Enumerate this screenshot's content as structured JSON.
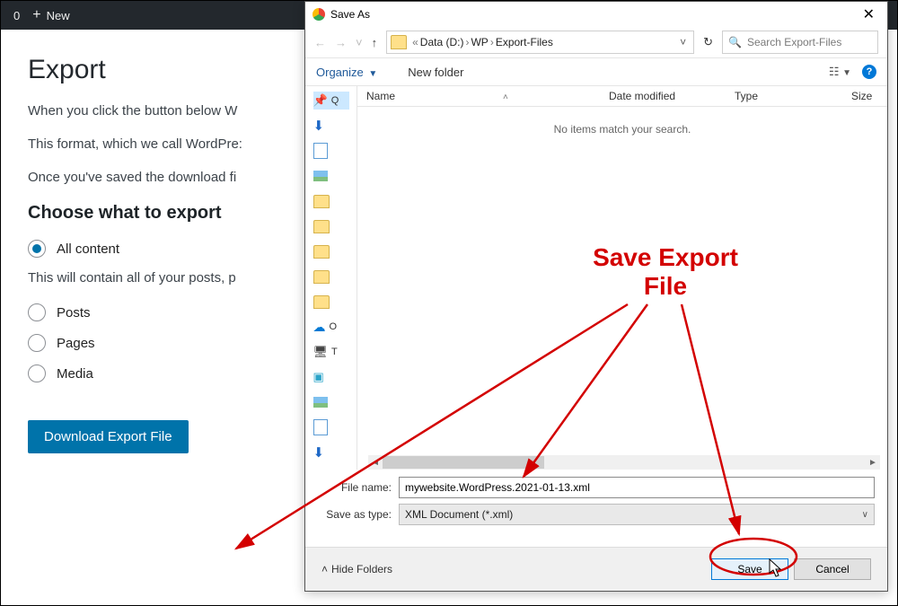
{
  "topbar": {
    "count": "0",
    "new_label": "New"
  },
  "export": {
    "heading": "Export",
    "p1": "When you click the button below W",
    "p2": "This format, which we call WordPre:",
    "p3": "Once you've saved the download fi",
    "choose_heading": "Choose what to export",
    "opt_all": "All content",
    "all_desc": "This will contain all of your posts, p",
    "opt_posts": "Posts",
    "opt_pages": "Pages",
    "opt_media": "Media",
    "download_btn": "Download Export File"
  },
  "dialog": {
    "title": "Save As",
    "crumb1": "Data (D:)",
    "crumb2": "WP",
    "crumb3": "Export-Files",
    "search_placeholder": "Search Export-Files",
    "organize": "Organize",
    "new_folder": "New folder",
    "col_name": "Name",
    "col_date": "Date modified",
    "col_type": "Type",
    "col_size": "Size",
    "empty_msg": "No items match your search.",
    "tree_q": "Q",
    "tree_o": "O",
    "tree_t": "T",
    "fname_label": "File name:",
    "fname_value": "mywebsite.WordPress.2021-01-13.xml",
    "ftype_label": "Save as type:",
    "ftype_value": "XML Document (*.xml)",
    "hide_folders": "Hide Folders",
    "save": "Save",
    "cancel": "Cancel"
  },
  "annotation": {
    "label_line1": "Save Export",
    "label_line2": "File"
  }
}
